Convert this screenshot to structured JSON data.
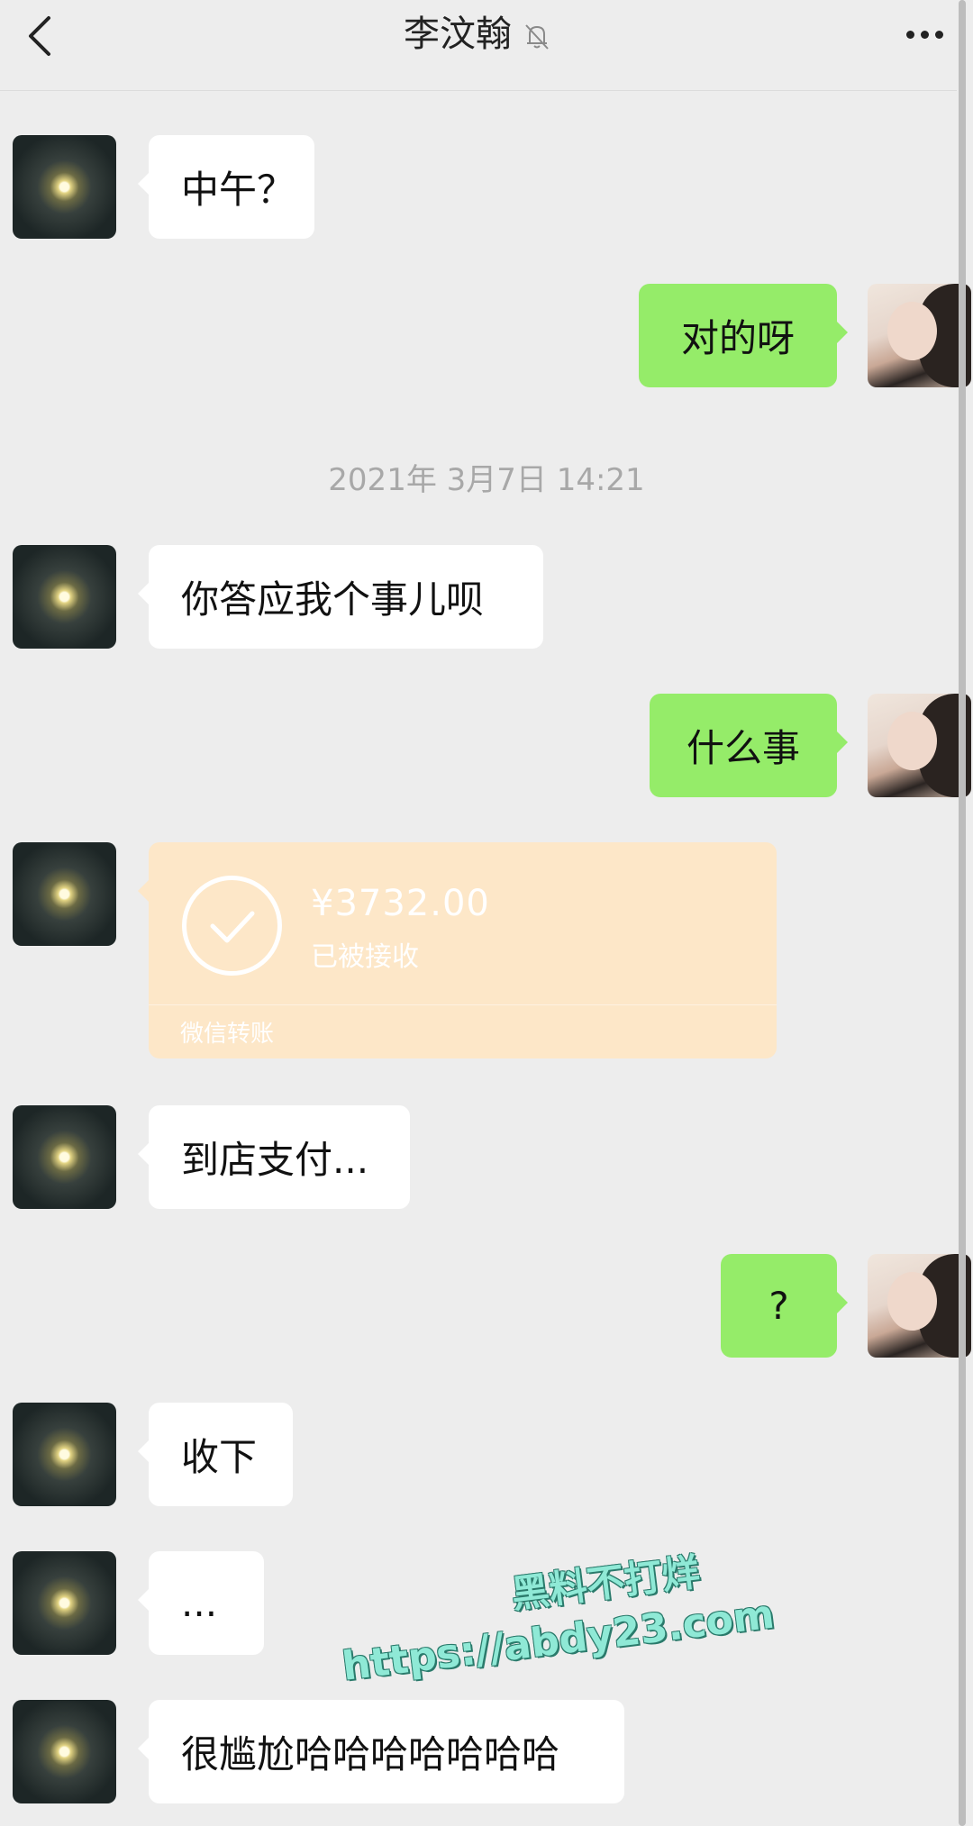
{
  "header": {
    "title": "李汶翰",
    "back_icon": "chevron-left-icon",
    "mute_icon": "bell-off-icon",
    "more_icon": "more-dots-icon"
  },
  "messages": [
    {
      "side": "left",
      "text": "中午？"
    },
    {
      "side": "right",
      "text": "对的呀"
    },
    {
      "side": "left",
      "text": "你答应我个事儿呗"
    },
    {
      "side": "right",
      "text": "什么事"
    },
    {
      "side": "left",
      "text": "到店支付..."
    },
    {
      "side": "right",
      "text": "?"
    },
    {
      "side": "left",
      "text": "收下"
    },
    {
      "side": "left",
      "text": "..."
    },
    {
      "side": "left",
      "text": "很尴尬哈哈哈哈哈哈哈"
    }
  ],
  "timestamp": "2021年 3月7日 14:21",
  "transfer": {
    "amount": "¥3732.00",
    "status": "已被接收",
    "footer": "微信转账",
    "icon": "check-circle-icon"
  },
  "watermark": {
    "line1": "黑料不打烊",
    "line2": "https://abdy23.com"
  },
  "colors": {
    "background": "#ededed",
    "bubble_self": "#95ec69",
    "bubble_other": "#ffffff",
    "transfer_bg": "#fde7c8"
  }
}
